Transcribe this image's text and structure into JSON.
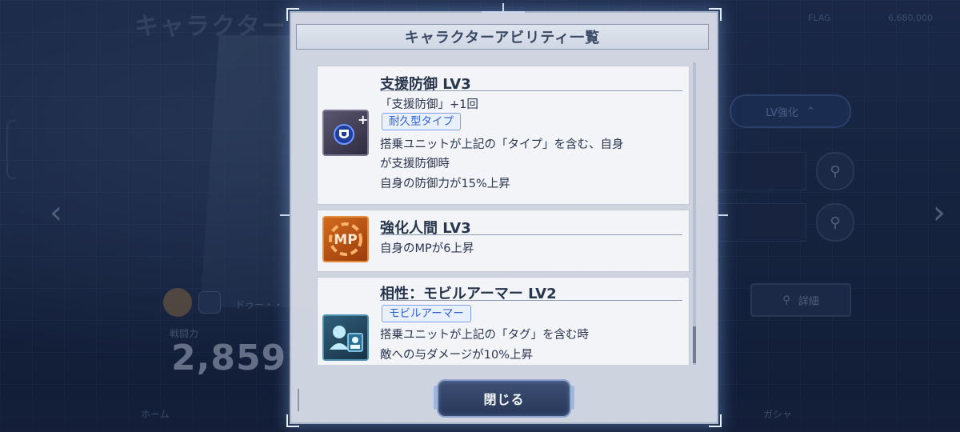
{
  "background": {
    "screen_title": "キャラクター",
    "top_right_text": [
      "FLAG",
      "6,680,000"
    ],
    "level_up_button": "LV強化",
    "detail_button": "詳細",
    "stat_label": "戦闘力",
    "stat_value": "2,859",
    "name_fragment": "ドゥー・・",
    "bottom_nav": [
      "ホーム",
      "ガシャ"
    ]
  },
  "dialog": {
    "title": "キャラクターアビリティ一覧",
    "abilities": [
      {
        "name": "支援防御 LV3",
        "icon": "shield-plus-icon",
        "lines_before_tag": [
          "「支援防御」+1回"
        ],
        "tag": "耐久型タイプ",
        "lines_after_tag": [
          "搭乗ユニットが上記の「タイプ」を含む、自身",
          "が支援防御時",
          "自身の防御力が15%上昇"
        ]
      },
      {
        "name": "強化人間 LV3",
        "icon": "mp-icon",
        "icon_text": "MP",
        "lines_before_tag": [
          "自身のMPが6上昇"
        ],
        "tag": "",
        "lines_after_tag": []
      },
      {
        "name": "相性：モビルアーマー LV2",
        "icon": "pilot-unit-icon",
        "lines_before_tag": [],
        "tag": "モビルアーマー",
        "lines_after_tag": [
          "搭乗ユニットが上記の「タグ」を含む時",
          "敵への与ダメージが10%上昇"
        ]
      }
    ],
    "close_button": "閉じる"
  },
  "colors": {
    "tag_text": "#2f61d8",
    "tag_border": "#7fa0e6",
    "title_text": "#3a4a66",
    "card_bg": "#f2f4f7",
    "button_bg": "#2f405f"
  }
}
